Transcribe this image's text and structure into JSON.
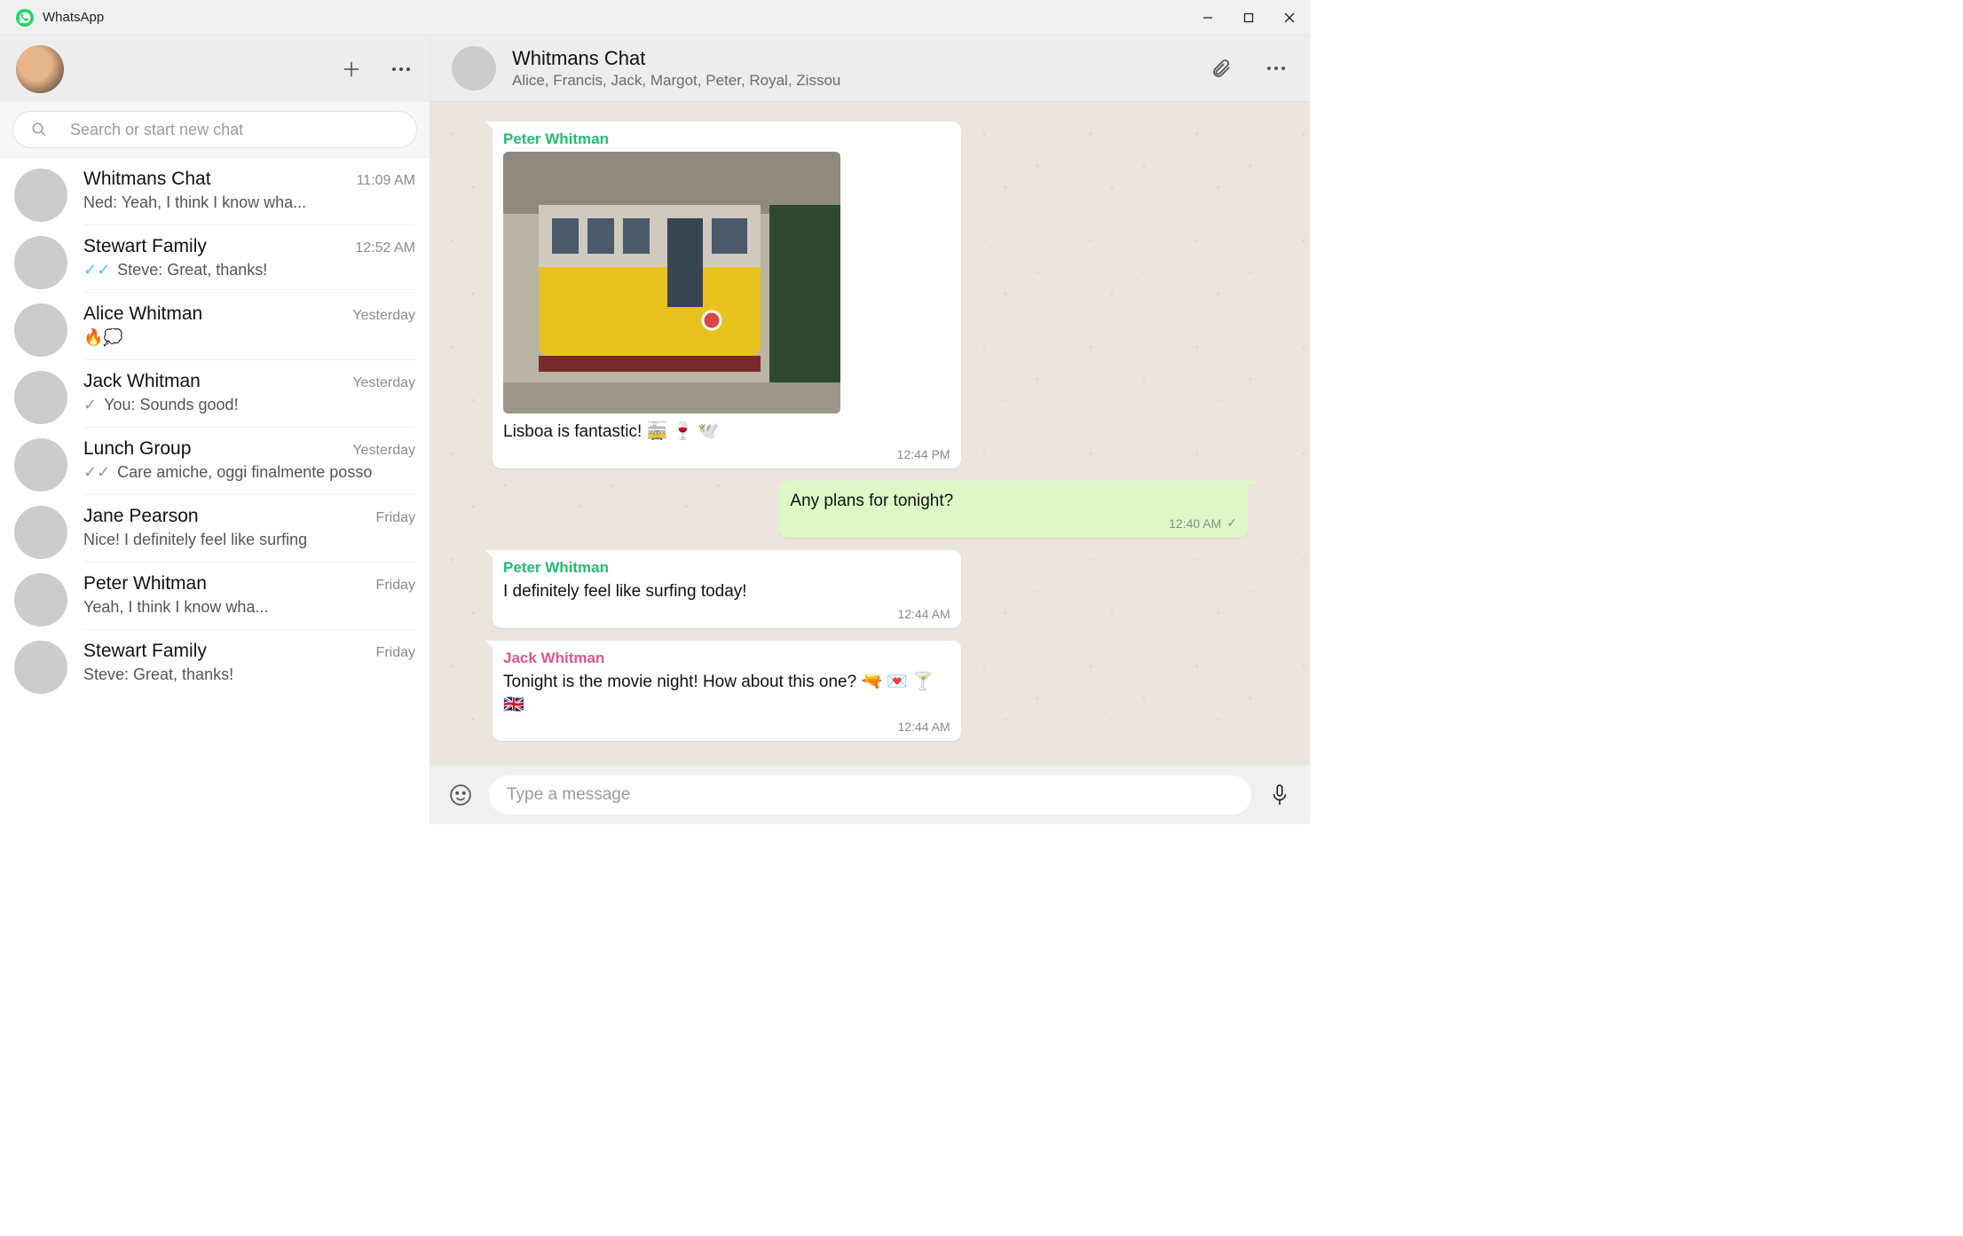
{
  "window": {
    "app_name": "WhatsApp"
  },
  "sidebar": {
    "search_placeholder": "Search or start new chat",
    "chats": [
      {
        "name": "Whitmans Chat",
        "time": "11:09 AM",
        "preview": "Ned: Yeah, I think I know wha...",
        "tick": ""
      },
      {
        "name": "Stewart Family",
        "time": "12:52 AM",
        "preview": "Steve: Great, thanks!",
        "tick": "read"
      },
      {
        "name": "Alice Whitman",
        "time": "Yesterday",
        "preview": "🔥💭",
        "tick": ""
      },
      {
        "name": "Jack Whitman",
        "time": "Yesterday",
        "preview": "You: Sounds good!",
        "tick": "sent"
      },
      {
        "name": "Lunch Group",
        "time": "Yesterday",
        "preview": "Care amiche, oggi finalmente posso",
        "tick": "sent-double"
      },
      {
        "name": "Jane Pearson",
        "time": "Friday",
        "preview": "Nice! I definitely feel like surfing",
        "tick": ""
      },
      {
        "name": "Peter Whitman",
        "time": "Friday",
        "preview": "Yeah, I think I know wha...",
        "tick": ""
      },
      {
        "name": "Stewart Family",
        "time": "Friday",
        "preview": "Steve: Great, thanks!",
        "tick": ""
      }
    ]
  },
  "chat": {
    "title": "Whitmans Chat",
    "subtitle": "Alice, Francis, Jack, Margot, Peter, Royal, Zissou",
    "composer_placeholder": "Type a message",
    "messages": [
      {
        "dir": "in",
        "sender": "Peter Whitman",
        "sender_color": "#1fbe72",
        "has_image": true,
        "text": "Lisboa is fantastic!  🚋 🍷 🕊️",
        "time": "12:44 PM"
      },
      {
        "dir": "out",
        "sender": "",
        "sender_color": "",
        "has_image": false,
        "text": "Any plans for tonight?",
        "time": "12:40 AM"
      },
      {
        "dir": "in",
        "sender": "Peter Whitman",
        "sender_color": "#1fbe72",
        "has_image": false,
        "text": "I definitely feel like surfing today!",
        "time": "12:44 AM"
      },
      {
        "dir": "in",
        "sender": "Jack Whitman",
        "sender_color": "#e0558f",
        "has_image": false,
        "text": "Tonight is the movie night! How about this one?  🔫 💌 🍸 🇬🇧",
        "time": "12:44 AM"
      }
    ]
  }
}
